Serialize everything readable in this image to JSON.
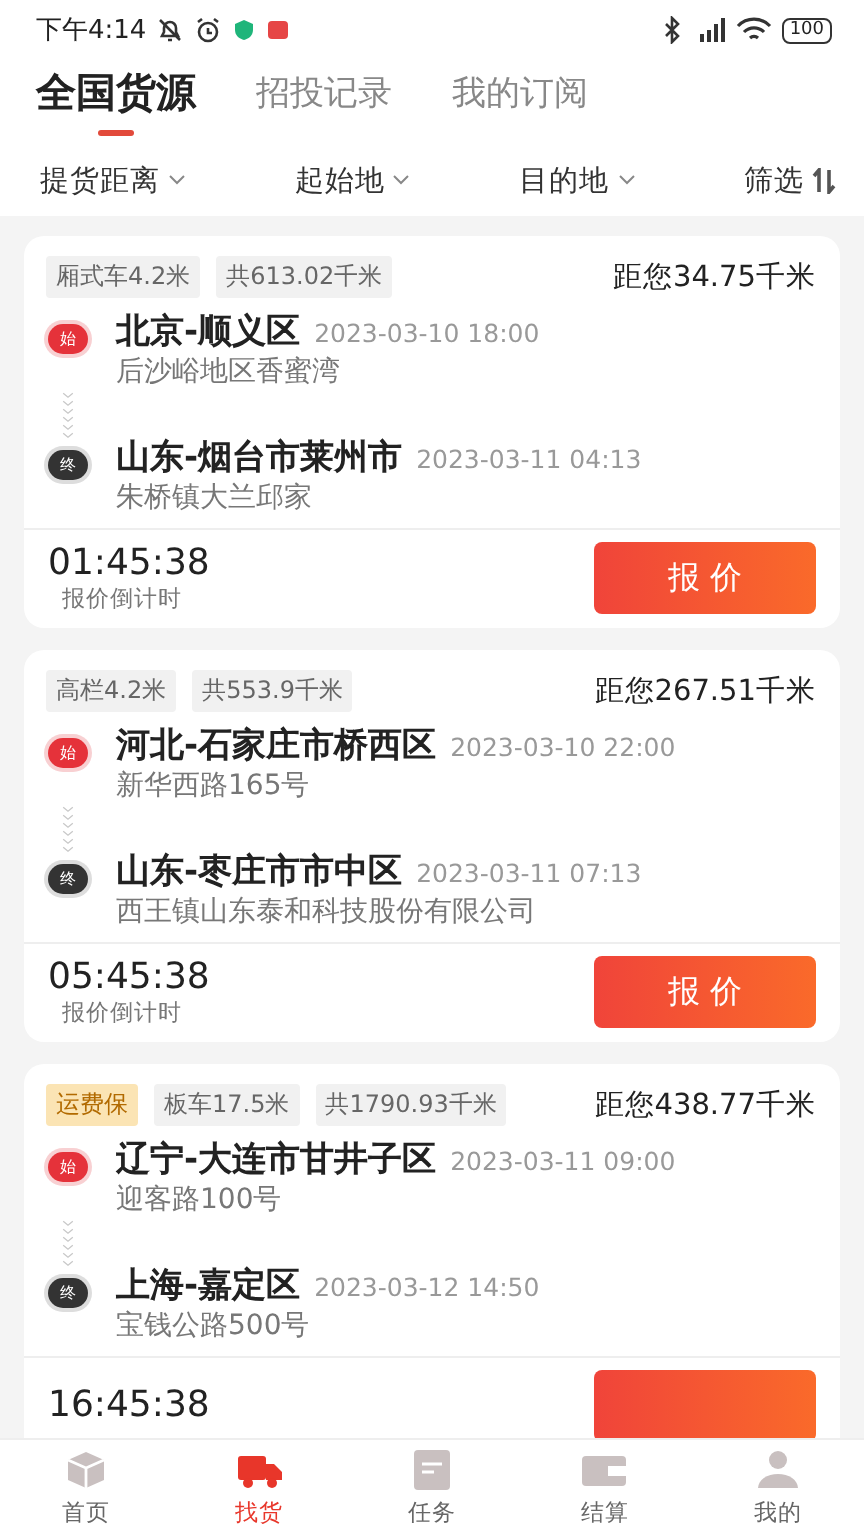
{
  "status_bar": {
    "time": "下午4:14",
    "battery": "100"
  },
  "tabs": [
    {
      "label": "全国货源",
      "selected": true
    },
    {
      "label": "招投记录",
      "selected": false
    },
    {
      "label": "我的订阅",
      "selected": false
    }
  ],
  "filters": [
    {
      "label": "提货距离",
      "kind": "dropdown"
    },
    {
      "label": "起始地",
      "kind": "dropdown"
    },
    {
      "label": "目的地",
      "kind": "dropdown"
    },
    {
      "label": "筛选",
      "kind": "sort"
    }
  ],
  "cards": [
    {
      "tags": [
        {
          "text": "厢式车4.2米",
          "kind": "plain"
        },
        {
          "text": "共613.02千米",
          "kind": "plain"
        }
      ],
      "distance": "距您34.75千米",
      "origin": {
        "badge": "始",
        "city": "北京-顺义区",
        "time": "2023-03-10 18:00",
        "address": "后沙峪地区香蜜湾"
      },
      "destination": {
        "badge": "终",
        "city": "山东-烟台市莱州市",
        "time": "2023-03-11 04:13",
        "address": "朱桥镇大兰邱家"
      },
      "countdown": "01:45:38",
      "countdown_label": "报价倒计时",
      "button": "报 价"
    },
    {
      "tags": [
        {
          "text": "高栏4.2米",
          "kind": "plain"
        },
        {
          "text": "共553.9千米",
          "kind": "plain"
        }
      ],
      "distance": "距您267.51千米",
      "origin": {
        "badge": "始",
        "city": "河北-石家庄市桥西区",
        "time": "2023-03-10 22:00",
        "address": "新华西路165号"
      },
      "destination": {
        "badge": "终",
        "city": "山东-枣庄市市中区",
        "time": "2023-03-11 07:13",
        "address": "西王镇山东泰和科技股份有限公司"
      },
      "countdown": "05:45:38",
      "countdown_label": "报价倒计时",
      "button": "报 价"
    },
    {
      "tags": [
        {
          "text": "运费保",
          "kind": "insurance"
        },
        {
          "text": "板车17.5米",
          "kind": "plain"
        },
        {
          "text": "共1790.93千米",
          "kind": "plain"
        }
      ],
      "distance": "距您438.77千米",
      "origin": {
        "badge": "始",
        "city": "辽宁-大连市甘井子区",
        "time": "2023-03-11 09:00",
        "address": "迎客路100号"
      },
      "destination": {
        "badge": "终",
        "city": "上海-嘉定区",
        "time": "2023-03-12 14:50",
        "address": "宝钱公路500号"
      },
      "countdown": "16:45:38"
    }
  ],
  "nav": [
    {
      "label": "首页",
      "selected": false
    },
    {
      "label": "找货",
      "selected": true
    },
    {
      "label": "任务",
      "selected": false
    },
    {
      "label": "结算",
      "selected": false
    },
    {
      "label": "我的",
      "selected": false
    }
  ]
}
